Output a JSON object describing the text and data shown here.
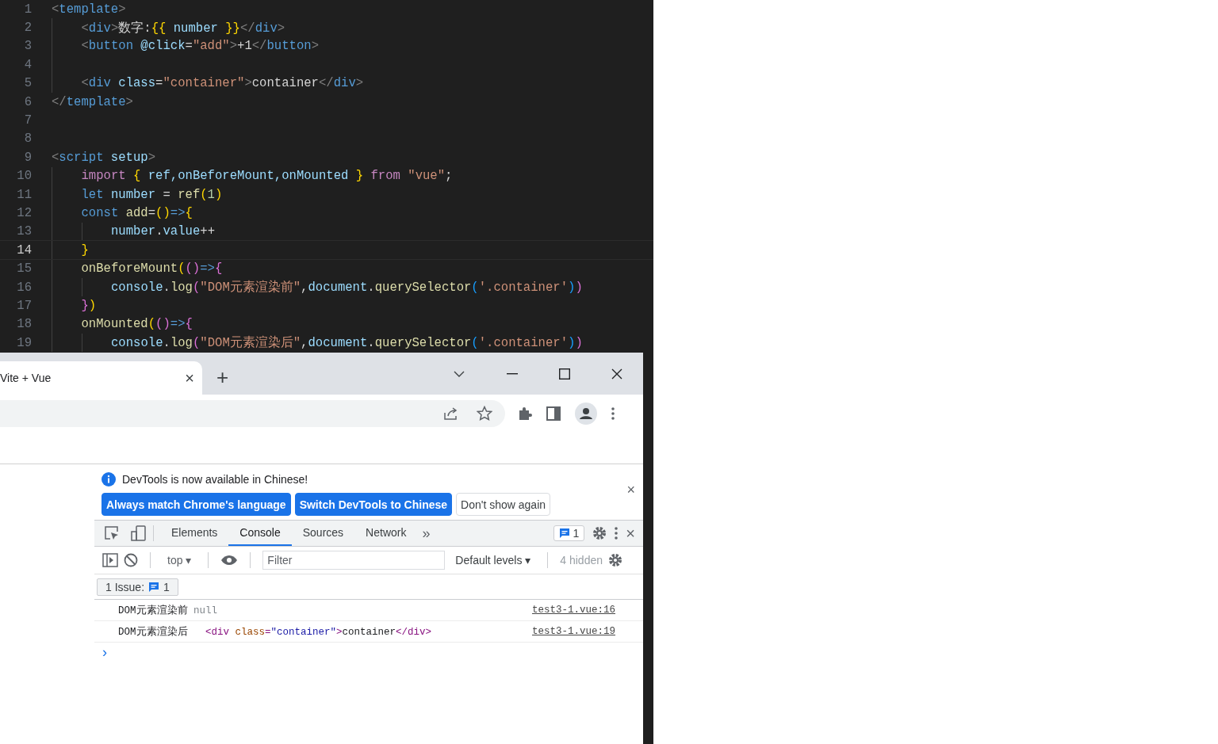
{
  "editor": {
    "lines": [
      {
        "number": "1",
        "current": false,
        "tokens": [
          {
            "kind": "tag",
            "text": "<"
          },
          {
            "kind": "tagname",
            "text": "template"
          },
          {
            "kind": "tag",
            "text": ">"
          }
        ],
        "children": [
          {
            "number": "2",
            "current": false,
            "tokens": [
              {
                "kind": "tag",
                "text": "<"
              },
              {
                "kind": "tagname",
                "text": "div"
              },
              {
                "kind": "tag",
                "text": ">"
              },
              {
                "kind": "text",
                "text": "数字:"
              },
              {
                "kind": "brace1",
                "text": "{{"
              },
              {
                "kind": "var",
                "text": " number "
              },
              {
                "kind": "brace1",
                "text": "}}"
              },
              {
                "kind": "tag",
                "text": "</"
              },
              {
                "kind": "tagname",
                "text": "div"
              },
              {
                "kind": "tag",
                "text": ">"
              }
            ]
          },
          {
            "number": "3",
            "current": false,
            "tokens": [
              {
                "kind": "tag",
                "text": "<"
              },
              {
                "kind": "tagname",
                "text": "button"
              },
              {
                "kind": "attr",
                "text": " @click"
              },
              {
                "kind": "text",
                "text": "="
              },
              {
                "kind": "str",
                "text": "\"add\""
              },
              {
                "kind": "tag",
                "text": ">"
              },
              {
                "kind": "text",
                "text": "+1"
              },
              {
                "kind": "tag",
                "text": "</"
              },
              {
                "kind": "tagname",
                "text": "button"
              },
              {
                "kind": "tag",
                "text": ">"
              }
            ]
          },
          {
            "number": "4",
            "current": false
          },
          {
            "number": "5",
            "current": false,
            "tokens": [
              {
                "kind": "tag",
                "text": "<"
              },
              {
                "kind": "tagname",
                "text": "div"
              },
              {
                "kind": "attr",
                "text": " class"
              },
              {
                "kind": "text",
                "text": "="
              },
              {
                "kind": "str",
                "text": "\"container\""
              },
              {
                "kind": "tag",
                "text": ">"
              },
              {
                "kind": "text",
                "text": "container"
              },
              {
                "kind": "tag",
                "text": "</"
              },
              {
                "kind": "tagname",
                "text": "div"
              },
              {
                "kind": "tag",
                "text": ">"
              }
            ]
          }
        ]
      },
      {
        "number": "6",
        "current": false,
        "tokens": [
          {
            "kind": "tag",
            "text": "</"
          },
          {
            "kind": "tagname",
            "text": "template"
          },
          {
            "kind": "tag",
            "text": ">"
          }
        ]
      },
      {
        "number": "7",
        "current": false
      },
      {
        "number": "8",
        "current": false
      },
      {
        "number": "9",
        "current": false,
        "tokens": [
          {
            "kind": "tag",
            "text": "<"
          },
          {
            "kind": "tagname",
            "text": "script"
          },
          {
            "kind": "attr",
            "text": " setup"
          },
          {
            "kind": "tag",
            "text": ">"
          }
        ],
        "children": [
          {
            "number": "10",
            "current": false,
            "tokens": [
              {
                "kind": "control",
                "text": "import"
              },
              {
                "kind": "brace1",
                "text": " {"
              },
              {
                "kind": "var",
                "text": " ref,onBeforeMount,onMounted "
              },
              {
                "kind": "brace1",
                "text": "}"
              },
              {
                "kind": "control",
                "text": " from"
              },
              {
                "kind": "str",
                "text": " \"vue\""
              },
              {
                "kind": "text",
                "text": ";"
              }
            ]
          },
          {
            "number": "11",
            "current": false,
            "tokens": [
              {
                "kind": "kw",
                "text": "let"
              },
              {
                "kind": "var",
                "text": " number"
              },
              {
                "kind": "text",
                "text": " = "
              },
              {
                "kind": "fn",
                "text": "ref"
              },
              {
                "kind": "brace1",
                "text": "("
              },
              {
                "kind": "num",
                "text": "1"
              },
              {
                "kind": "brace1",
                "text": ")"
              }
            ]
          },
          {
            "number": "12",
            "current": false,
            "tokens": [
              {
                "kind": "kw",
                "text": "const"
              },
              {
                "kind": "fn",
                "text": " add"
              },
              {
                "kind": "text",
                "text": "="
              },
              {
                "kind": "brace1",
                "text": "()"
              },
              {
                "kind": "kw",
                "text": "=>"
              },
              {
                "kind": "brace1",
                "text": "{"
              }
            ],
            "children": [
              {
                "number": "13",
                "current": false,
                "tokens": [
                  {
                    "kind": "var",
                    "text": "number"
                  },
                  {
                    "kind": "text",
                    "text": "."
                  },
                  {
                    "kind": "var",
                    "text": "value"
                  },
                  {
                    "kind": "text",
                    "text": "++"
                  }
                ]
              }
            ]
          },
          {
            "number": "14",
            "current": true,
            "tokens": [
              {
                "kind": "brace1",
                "text": "}"
              }
            ]
          },
          {
            "number": "15",
            "current": false,
            "tokens": [
              {
                "kind": "fn",
                "text": "onBeforeMount"
              },
              {
                "kind": "brace1",
                "text": "("
              },
              {
                "kind": "brace2",
                "text": "()"
              },
              {
                "kind": "kw",
                "text": "=>"
              },
              {
                "kind": "brace2",
                "text": "{"
              }
            ],
            "children": [
              {
                "number": "16",
                "current": false,
                "tokens": [
                  {
                    "kind": "var",
                    "text": "console"
                  },
                  {
                    "kind": "text",
                    "text": "."
                  },
                  {
                    "kind": "fn",
                    "text": "log"
                  },
                  {
                    "kind": "brace2",
                    "text": "("
                  },
                  {
                    "kind": "str",
                    "text": "\"DOM元素渲染前\""
                  },
                  {
                    "kind": "text",
                    "text": ","
                  },
                  {
                    "kind": "var",
                    "text": "document"
                  },
                  {
                    "kind": "text",
                    "text": "."
                  },
                  {
                    "kind": "fn",
                    "text": "querySelector"
                  },
                  {
                    "kind": "brace3",
                    "text": "("
                  },
                  {
                    "kind": "str",
                    "text": "'.container'"
                  },
                  {
                    "kind": "brace3",
                    "text": ")"
                  },
                  {
                    "kind": "brace2",
                    "text": ")"
                  }
                ]
              }
            ]
          },
          {
            "number": "17",
            "current": false,
            "tokens": [
              {
                "kind": "brace2",
                "text": "}"
              },
              {
                "kind": "brace1",
                "text": ")"
              }
            ]
          },
          {
            "number": "18",
            "current": false,
            "tokens": [
              {
                "kind": "fn",
                "text": "onMounted"
              },
              {
                "kind": "brace1",
                "text": "("
              },
              {
                "kind": "brace2",
                "text": "()"
              },
              {
                "kind": "kw",
                "text": "=>"
              },
              {
                "kind": "brace2",
                "text": "{"
              }
            ],
            "children": [
              {
                "number": "19",
                "current": false,
                "tokens": [
                  {
                    "kind": "var",
                    "text": "console"
                  },
                  {
                    "kind": "text",
                    "text": "."
                  },
                  {
                    "kind": "fn",
                    "text": "log"
                  },
                  {
                    "kind": "brace2",
                    "text": "("
                  },
                  {
                    "kind": "str",
                    "text": "\"DOM元素渲染后\""
                  },
                  {
                    "kind": "text",
                    "text": ","
                  },
                  {
                    "kind": "var",
                    "text": "document"
                  },
                  {
                    "kind": "text",
                    "text": "."
                  },
                  {
                    "kind": "fn",
                    "text": "querySelector"
                  },
                  {
                    "kind": "brace3",
                    "text": "("
                  },
                  {
                    "kind": "str",
                    "text": "'.container'"
                  },
                  {
                    "kind": "brace3",
                    "text": ")"
                  },
                  {
                    "kind": "brace2",
                    "text": ")"
                  }
                ]
              }
            ]
          }
        ]
      }
    ]
  },
  "browser": {
    "tab": {
      "title": "Vite + Vue",
      "close": "×"
    },
    "new_tab": "+"
  },
  "devtools": {
    "infobar": {
      "message": "DevTools is now available in Chinese!",
      "buttons": [
        {
          "label": "Always match Chrome's language",
          "kind": "primary"
        },
        {
          "label": "Switch DevTools to Chinese",
          "kind": "primary"
        },
        {
          "label": "Don't show again",
          "kind": "plain"
        }
      ],
      "close": "×"
    },
    "tabs": [
      {
        "label": "Elements",
        "selected": false
      },
      {
        "label": "Console",
        "selected": true
      },
      {
        "label": "Sources",
        "selected": false
      },
      {
        "label": "Network",
        "selected": false
      }
    ],
    "more_tabs": "»",
    "issues_badge": "1",
    "close": "×",
    "toolbar": {
      "context": "top",
      "context_caret": "▾",
      "filter_placeholder": "Filter",
      "levels": "Default levels",
      "levels_caret": "▾",
      "hidden": "4 hidden"
    },
    "issues": {
      "label": "1 Issue:",
      "count": "1"
    },
    "messages": [
      {
        "tokens": [
          {
            "kind": "text",
            "text": "DOM元素渲染前 "
          },
          {
            "kind": "null",
            "text": "null"
          }
        ],
        "source": "test3-1.vue:16"
      },
      {
        "tokens": [
          {
            "kind": "text",
            "text": "DOM元素渲染后   "
          },
          {
            "kind": "htag",
            "text": "<div"
          },
          {
            "kind": "hattr",
            "text": " class"
          },
          {
            "kind": "htag",
            "text": "="
          },
          {
            "kind": "hval",
            "text": "\"container\""
          },
          {
            "kind": "htag",
            "text": ">"
          },
          {
            "kind": "text",
            "text": "container"
          },
          {
            "kind": "htag",
            "text": "</div>"
          }
        ],
        "source": "test3-1.vue:19"
      }
    ],
    "prompt": "›"
  }
}
